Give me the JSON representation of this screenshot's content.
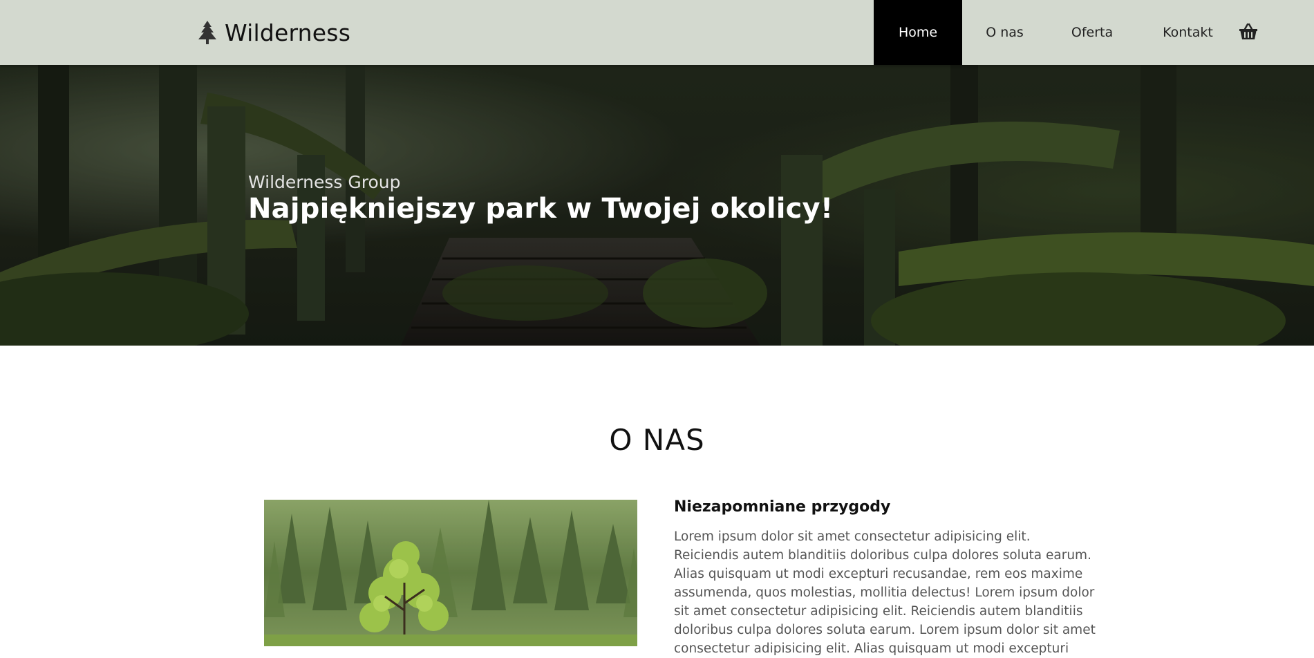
{
  "brand": {
    "name": "Wilderness",
    "icon": "tree-icon"
  },
  "nav": {
    "items": [
      {
        "label": "Home",
        "active": true
      },
      {
        "label": "O nas",
        "active": false
      },
      {
        "label": "Oferta",
        "active": false
      },
      {
        "label": "Kontakt",
        "active": false
      }
    ],
    "cart_icon": "basket-icon"
  },
  "hero": {
    "subtitle": "Wilderness Group",
    "title": "Najpiękniejszy park w Twojej okolicy!"
  },
  "about": {
    "heading": "O NAS",
    "card_title": "Niezapomniane przygody",
    "card_text": "Lorem ipsum dolor sit amet consectetur adipisicing elit. Reiciendis autem blanditiis doloribus culpa dolores soluta earum. Alias quisquam ut modi excepturi recusandae, rem eos maxime assumenda, quos molestias, mollitia delectus! Lorem ipsum dolor sit amet consectetur adipisicing elit. Reiciendis autem blanditiis doloribus culpa dolores soluta earum. Lorem ipsum dolor sit amet consectetur adipisicing elit. Alias quisquam ut modi excepturi"
  },
  "colors": {
    "header_bg": "#d3d9cf",
    "nav_active_bg": "#000000",
    "nav_active_text": "#ffffff",
    "text_muted": "#555555"
  }
}
